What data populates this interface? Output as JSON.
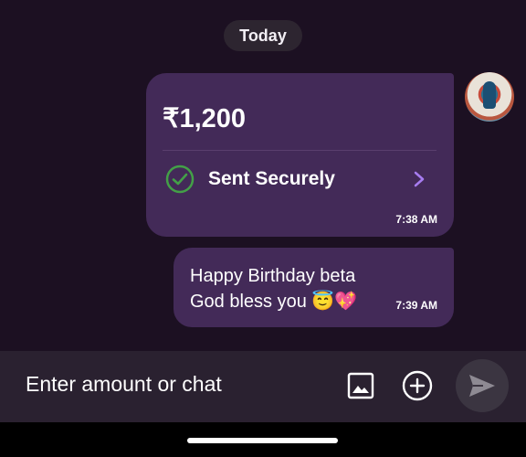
{
  "date_divider": {
    "label": "Today"
  },
  "payment": {
    "amount": "₹1,200",
    "status": "Sent Securely",
    "time": "7:38 AM",
    "status_color": "#43a047",
    "chevron_color": "#a77cf0"
  },
  "message": {
    "lines": [
      "Happy Birthday beta",
      "God bless you 😇💖"
    ],
    "time": "7:39 AM"
  },
  "composer": {
    "placeholder": "Enter amount or chat",
    "icons": [
      "image-icon",
      "add-circle-icon",
      "send-icon"
    ]
  },
  "colors": {
    "background": "#1c1022",
    "bubble": "#432a58",
    "input_bar": "#2a2130"
  }
}
